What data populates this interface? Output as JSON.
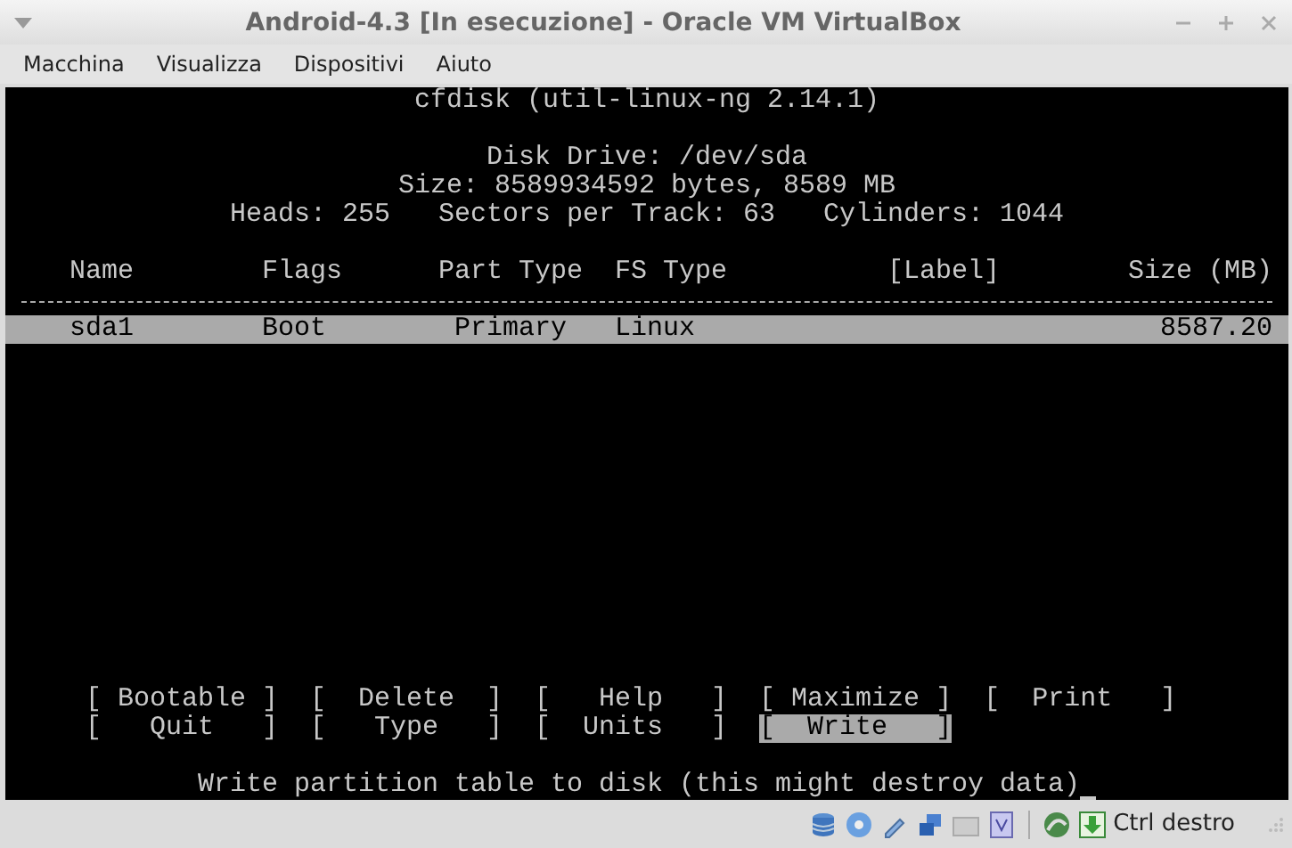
{
  "window": {
    "title": "Android-4.3 [In esecuzione] - Oracle VM VirtualBox"
  },
  "menu": [
    "Macchina",
    "Visualizza",
    "Dispositivi",
    "Aiuto"
  ],
  "terminal": {
    "title": "cfdisk (util-linux-ng 2.14.1)",
    "info": [
      "Disk Drive: /dev/sda",
      "Size: 8589934592 bytes, 8589 MB",
      "Heads: 255   Sectors per Track: 63   Cylinders: 1044"
    ],
    "columns": [
      "Name",
      "Flags",
      "Part Type",
      "FS Type",
      "[Label]",
      "Size (MB)"
    ],
    "partitions": [
      {
        "name": "sda1",
        "flags": "Boot",
        "part_type": "Primary",
        "fs_type": "Linux",
        "size": "8587.20",
        "selected": true
      }
    ],
    "buttons": [
      [
        {
          "label": "[ Bootable ]",
          "selected": false
        },
        {
          "label": "[  Delete  ]",
          "selected": false
        },
        {
          "label": "[   Help   ]",
          "selected": false
        },
        {
          "label": "[ Maximize ]",
          "selected": false
        },
        {
          "label": "[  Print   ]",
          "selected": false
        }
      ],
      [
        {
          "label": "[   Quit   ]",
          "selected": false
        },
        {
          "label": "[   Type   ]",
          "selected": false
        },
        {
          "label": "[  Units   ]",
          "selected": false
        },
        {
          "label": "[  Write   ]",
          "selected": true
        }
      ]
    ],
    "message": "Write partition table to disk (this might destroy data)"
  },
  "status_bar": {
    "host_key": "Ctrl destro"
  }
}
